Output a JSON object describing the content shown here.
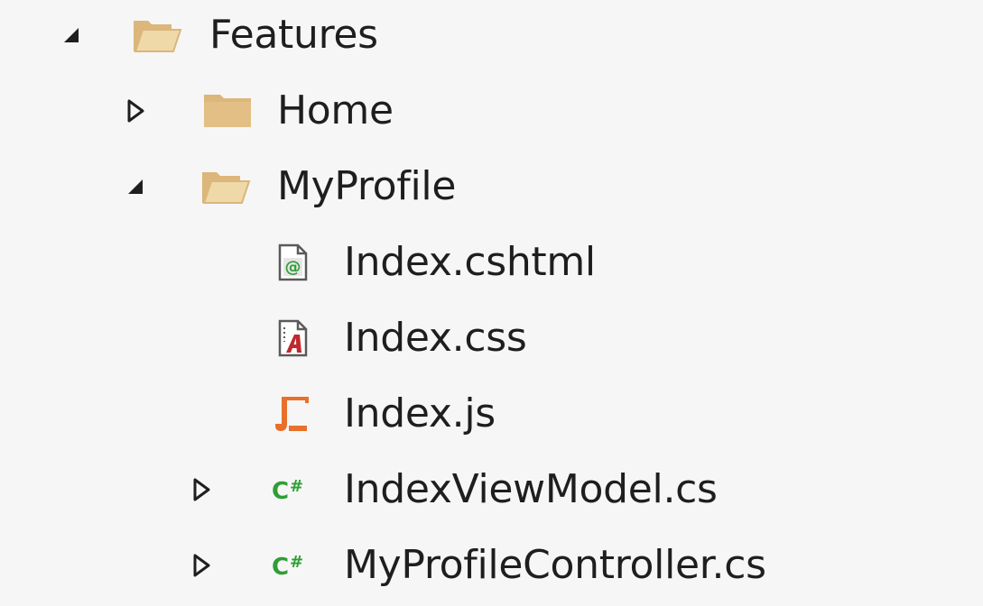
{
  "tree": {
    "items": [
      {
        "label": "Features",
        "icon": "folder-open-icon",
        "expander": "expanded"
      },
      {
        "label": "Home",
        "icon": "folder-closed-icon",
        "expander": "collapsed"
      },
      {
        "label": "MyProfile",
        "icon": "folder-open-icon",
        "expander": "expanded"
      },
      {
        "label": "Index.cshtml",
        "icon": "razor-file-icon",
        "expander": "none"
      },
      {
        "label": "Index.css",
        "icon": "css-file-icon",
        "expander": "none"
      },
      {
        "label": "Index.js",
        "icon": "js-file-icon",
        "expander": "none"
      },
      {
        "label": "IndexViewModel.cs",
        "icon": "csharp-file-icon",
        "expander": "collapsed"
      },
      {
        "label": "MyProfileController.cs",
        "icon": "csharp-file-icon",
        "expander": "collapsed"
      }
    ]
  },
  "colors": {
    "background": "#f6f6f6",
    "folder": "#dcb67a",
    "arrow": "#1e1e1e",
    "csharp": "#2e9e34",
    "js": "#e8702a",
    "css_accent": "#c1272d"
  }
}
